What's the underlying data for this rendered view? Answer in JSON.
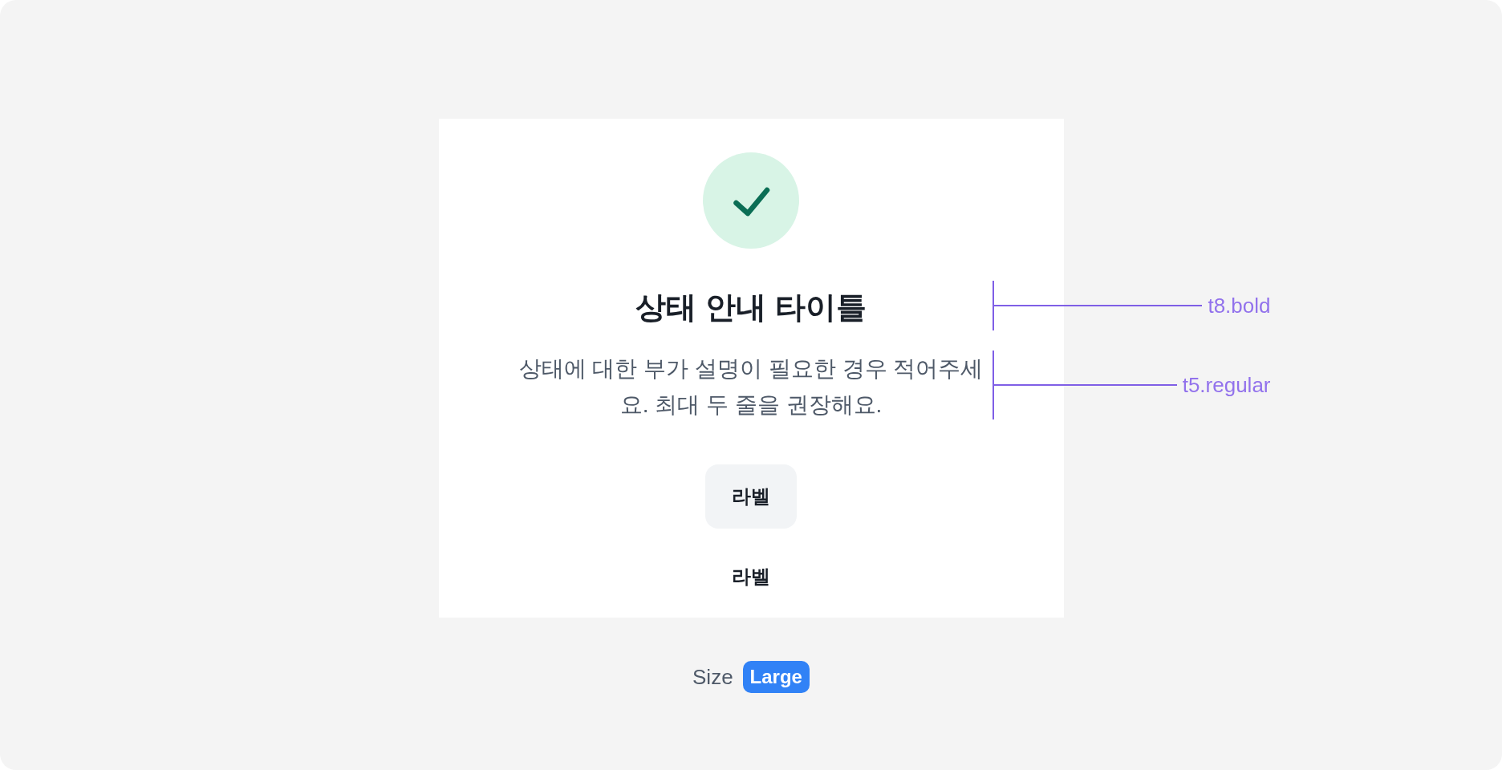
{
  "card": {
    "title": "상태 안내 타이틀",
    "description": "상태에 대한 부가 설명이 필요한 경우 적어주세요. 최대 두 줄을 권장해요.",
    "buttons": [
      {
        "label": "라벨",
        "kind": "filled"
      },
      {
        "label": "라벨",
        "kind": "text"
      }
    ]
  },
  "annotations": [
    {
      "label": "t8.bold"
    },
    {
      "label": "t5.regular"
    }
  ],
  "size": {
    "label": "Size",
    "value": "Large"
  }
}
